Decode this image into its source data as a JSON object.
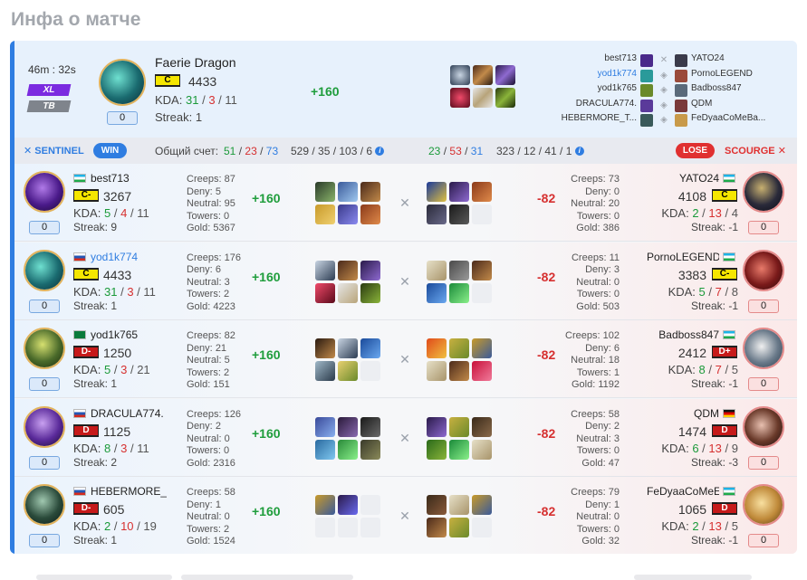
{
  "page_title": "Инфа о матче",
  "summary": {
    "duration": "46m : 32s",
    "tags": [
      "XL",
      "TB"
    ],
    "hero_name": "Faerie Dragon",
    "rank": "C",
    "mmr": "4433",
    "kda_label": "KDA:",
    "kills": "31",
    "deaths": "3",
    "assists": "11",
    "streak_label": "Streak:",
    "streak": "1",
    "rating_box": "0",
    "delta": "+160",
    "sentinel_team": [
      "best713",
      "yod1k774",
      "yod1k765",
      "DRACULA774.",
      "HEBERMORE_T..."
    ],
    "scourge_team": [
      "YATO24",
      "PornoLEGEND",
      "Badboss847",
      "QDM",
      "FeDyaaCoMeBa..."
    ]
  },
  "score_bar": {
    "sentinel_label": "SENTINEL",
    "win_label": "WIN",
    "total_label": "Общий счет:",
    "sent_k": "51",
    "sent_d": "23",
    "sent_a": "73",
    "sent_stats": "529 / 35 / 103 / 6",
    "scr_k": "23",
    "scr_d": "53",
    "scr_a": "31",
    "scr_stats": "323 / 12 / 41 / 1",
    "lose_label": "LOSE",
    "scourge_label": "SCOURGE",
    "slash": "/"
  },
  "labels": {
    "creeps": "Creeps:",
    "deny": "Deny:",
    "neutral": "Neutral:",
    "towers": "Towers:",
    "gold": "Gold:",
    "kda": "KDA:",
    "streak": "Streak:"
  },
  "colors": {
    "accent": "#2f7de1",
    "win": "#2f7de1",
    "lose": "#e03030",
    "kill": "#1b9a3a",
    "death": "#d63030"
  },
  "rows": [
    {
      "left": {
        "name": "best713",
        "flag": "uz",
        "rank": "C-",
        "rank_type": "c",
        "mmr": "3267",
        "k": "5",
        "d": "4",
        "a": "11",
        "streak": "9",
        "box": "0",
        "creeps": "87",
        "deny": "5",
        "neutral": "95",
        "towers": "0",
        "gold": "5367",
        "delta": "+160",
        "highlight": false
      },
      "right": {
        "name": "YATO24",
        "flag": "uz",
        "rank": "C",
        "rank_type": "c",
        "mmr": "4108",
        "k": "2",
        "d": "13",
        "a": "4",
        "streak": "-1",
        "box": "0",
        "creeps": "73",
        "deny": "0",
        "neutral": "20",
        "towers": "0",
        "gold": "386",
        "delta": "-82"
      }
    },
    {
      "left": {
        "name": "yod1k774",
        "flag": "ru",
        "rank": "C",
        "rank_type": "c",
        "mmr": "4433",
        "k": "31",
        "d": "3",
        "a": "11",
        "streak": "1",
        "box": "0",
        "creeps": "176",
        "deny": "6",
        "neutral": "3",
        "towers": "2",
        "gold": "4223",
        "delta": "+160",
        "highlight": true
      },
      "right": {
        "name": "PornoLEGEND",
        "flag": "uz",
        "rank": "C-",
        "rank_type": "c",
        "mmr": "3383",
        "k": "5",
        "d": "7",
        "a": "8",
        "streak": "-1",
        "box": "0",
        "creeps": "11",
        "deny": "3",
        "neutral": "0",
        "towers": "0",
        "gold": "503",
        "delta": "-82"
      }
    },
    {
      "left": {
        "name": "yod1k765",
        "flag": "sa",
        "rank": "D-",
        "rank_type": "d",
        "mmr": "1250",
        "k": "5",
        "d": "3",
        "a": "21",
        "streak": "1",
        "box": "0",
        "creeps": "82",
        "deny": "21",
        "neutral": "5",
        "towers": "2",
        "gold": "151",
        "delta": "+160",
        "highlight": false
      },
      "right": {
        "name": "Badboss847",
        "flag": "uz",
        "rank": "D+",
        "rank_type": "d",
        "mmr": "2412",
        "k": "8",
        "d": "7",
        "a": "5",
        "streak": "-1",
        "box": "0",
        "creeps": "102",
        "deny": "6",
        "neutral": "18",
        "towers": "1",
        "gold": "1192",
        "delta": "-82"
      }
    },
    {
      "left": {
        "name": "DRACULA774.",
        "flag": "ru",
        "rank": "D",
        "rank_type": "d",
        "mmr": "1125",
        "k": "8",
        "d": "3",
        "a": "11",
        "streak": "2",
        "box": "0",
        "creeps": "126",
        "deny": "2",
        "neutral": "0",
        "towers": "0",
        "gold": "2316",
        "delta": "+160",
        "highlight": false
      },
      "right": {
        "name": "QDM",
        "flag": "de",
        "rank": "D",
        "rank_type": "d",
        "mmr": "1474",
        "k": "6",
        "d": "13",
        "a": "9",
        "streak": "-3",
        "box": "0",
        "creeps": "58",
        "deny": "2",
        "neutral": "3",
        "towers": "0",
        "gold": "47",
        "delta": "-82"
      }
    },
    {
      "left": {
        "name": "HEBERMORE_",
        "flag": "ru",
        "rank": "D-",
        "rank_type": "d",
        "mmr": "605",
        "k": "2",
        "d": "10",
        "a": "19",
        "streak": "1",
        "box": "0",
        "creeps": "58",
        "deny": "1",
        "neutral": "0",
        "towers": "2",
        "gold": "1524",
        "delta": "+160",
        "highlight": false
      },
      "right": {
        "name": "FeDyaaCoMeE",
        "flag": "uz",
        "rank": "D",
        "rank_type": "d",
        "mmr": "1065",
        "k": "2",
        "d": "13",
        "a": "5",
        "streak": "-1",
        "box": "0",
        "creeps": "79",
        "deny": "1",
        "neutral": "0",
        "towers": "0",
        "gold": "32",
        "delta": "-82"
      }
    }
  ]
}
